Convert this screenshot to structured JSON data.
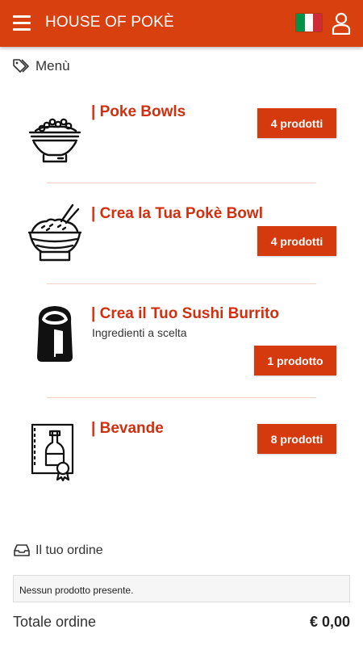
{
  "header": {
    "app_title": "HOUSE OF POKÈ",
    "flag_colors": [
      "#009246",
      "#ffffff",
      "#ce2b37"
    ],
    "accent": "#d94010"
  },
  "menu_section": {
    "title": "Menù"
  },
  "categories": [
    {
      "title": "| Poke Bowls",
      "subtitle": "",
      "button": "4 prodotti",
      "icon": "rice-bowl-icon"
    },
    {
      "title": "| Crea la Tua Pokè Bowl",
      "subtitle": "",
      "button": "4 prodotti",
      "icon": "bowl-chopsticks-icon"
    },
    {
      "title": "| Crea il Tuo Sushi Burrito",
      "subtitle": "Ingredienti a scelta",
      "button": "1 prodotto",
      "icon": "burrito-icon"
    },
    {
      "title": "| Bevande",
      "subtitle": "",
      "button": "8 prodotti",
      "icon": "bottle-icon"
    }
  ],
  "order": {
    "title": "Il tuo ordine",
    "empty_message": "Nessun prodotto presente.",
    "total_label": "Totale ordine",
    "total_value": "€ 0,00"
  }
}
